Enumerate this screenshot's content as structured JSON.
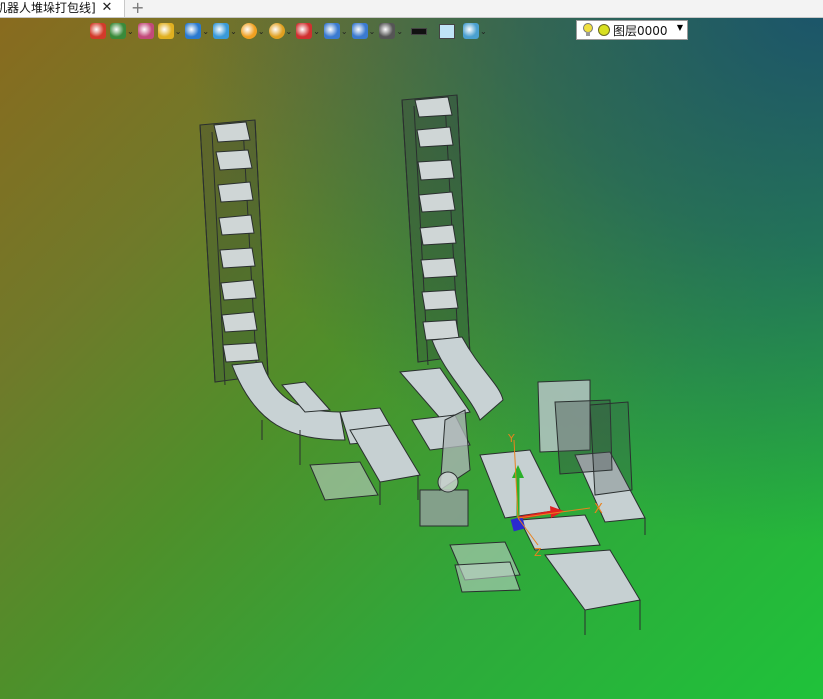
{
  "tab": {
    "title": "机器人堆垛打包线]",
    "close": "✕",
    "new": "+"
  },
  "toolbar": [
    {
      "name": "exit-icon",
      "color": "#d23a2a"
    },
    {
      "name": "person-icon",
      "color": "#3a8a3a"
    },
    {
      "name": "pen-icon",
      "color": "#c24a7a"
    },
    {
      "name": "cube-yellow-icon",
      "color": "#e0b020"
    },
    {
      "name": "cube-blue-icon",
      "color": "#2a7ad0"
    },
    {
      "name": "cube-faces-icon",
      "color": "#3a9ad8"
    },
    {
      "name": "orbit-icon",
      "color": "#f0a020"
    },
    {
      "name": "zoom-icon",
      "color": "#e0a020"
    },
    {
      "name": "pointer-icon",
      "color": "#d03030"
    },
    {
      "name": "box-icon",
      "color": "#3a7ad0"
    },
    {
      "name": "split-view-icon",
      "color": "#3a7ad0"
    },
    {
      "name": "monitor-icon",
      "color": "#555555"
    },
    {
      "name": "black-swatch-icon",
      "color": "#111111"
    },
    {
      "name": "lightblue-swatch-icon",
      "color": "#bfe4f6"
    },
    {
      "name": "layer-stack-icon",
      "color": "#4aa0d0"
    }
  ],
  "layer": {
    "label": "图层0000",
    "bulb_color": "#f0e040",
    "dot_color": "#d8e020"
  },
  "axes": {
    "x_label": "X",
    "y_label": "Y",
    "z_label": "Z"
  }
}
